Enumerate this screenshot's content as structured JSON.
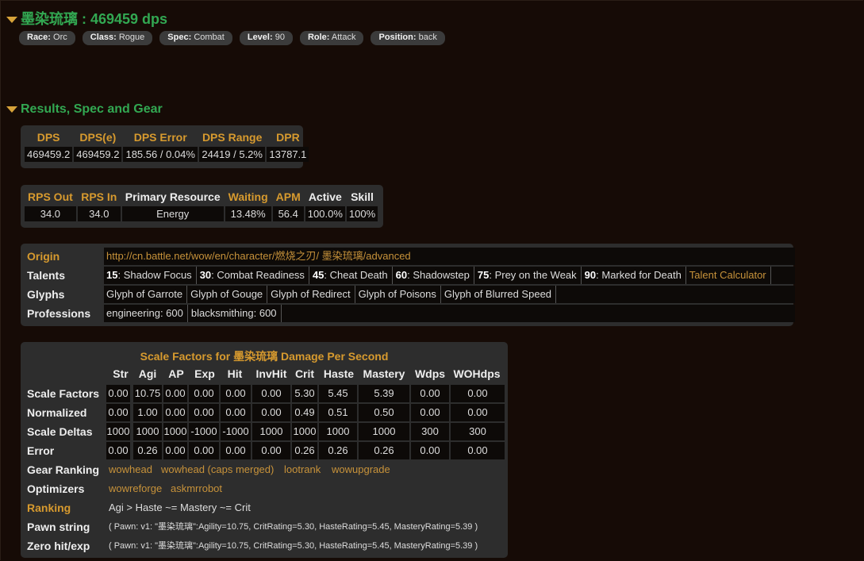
{
  "header": {
    "title": "墨染琉璃 : 469459 dps",
    "pills": [
      {
        "key": "Race:",
        "val": "Orc"
      },
      {
        "key": "Class:",
        "val": "Rogue"
      },
      {
        "key": "Spec:",
        "val": "Combat"
      },
      {
        "key": "Level:",
        "val": "90"
      },
      {
        "key": "Role:",
        "val": "Attack"
      },
      {
        "key": "Position:",
        "val": "back"
      }
    ]
  },
  "section": {
    "title": "Results, Spec and Gear"
  },
  "results1": {
    "headers": [
      "DPS",
      "DPS(e)",
      "DPS Error",
      "DPS Range",
      "DPR"
    ],
    "values": [
      "469459.2",
      "469459.2",
      "185.56 / 0.04%",
      "24419 / 5.2%",
      "13787.1"
    ]
  },
  "results2": {
    "headers": [
      "RPS Out",
      "RPS In",
      "Primary Resource",
      "Waiting",
      "APM",
      "Active",
      "Skill"
    ],
    "values": [
      "34.0",
      "34.0",
      "Energy",
      "13.48%",
      "56.4",
      "100.0%",
      "100%"
    ]
  },
  "info": {
    "origin_label": "Origin",
    "origin_url": "http://cn.battle.net/wow/en/character/燃烧之刃/ 墨染琉璃/advanced",
    "talents_label": "Talents",
    "talents": [
      {
        "tier": "15",
        "name": ": Shadow Focus"
      },
      {
        "tier": "30",
        "name": ": Combat Readiness"
      },
      {
        "tier": "45",
        "name": ": Cheat Death"
      },
      {
        "tier": "60",
        "name": ": Shadowstep"
      },
      {
        "tier": "75",
        "name": ": Prey on the Weak"
      },
      {
        "tier": "90",
        "name": ": Marked for Death"
      }
    ],
    "talent_calc": "Talent Calculator",
    "glyphs_label": "Glyphs",
    "glyphs": [
      "Glyph of Garrote",
      "Glyph of Gouge",
      "Glyph of Redirect",
      "Glyph of Poisons",
      "Glyph of Blurred Speed"
    ],
    "professions_label": "Professions",
    "professions": [
      "engineering: 600",
      "blacksmithing: 600"
    ]
  },
  "scale": {
    "title": "Scale Factors for 墨染琉璃 Damage Per Second",
    "headers": [
      "Str",
      "Agi",
      "AP",
      "Exp",
      "Hit",
      "InvHit",
      "Crit",
      "Haste",
      "Mastery",
      "Wdps",
      "WOHdps"
    ],
    "rows": [
      {
        "label": "Scale Factors",
        "values": [
          "0.00",
          "10.75",
          "0.00",
          "0.00",
          "0.00",
          "0.00",
          "5.30",
          "5.45",
          "5.39",
          "0.00",
          "0.00"
        ]
      },
      {
        "label": "Normalized",
        "values": [
          "0.00",
          "1.00",
          "0.00",
          "0.00",
          "0.00",
          "0.00",
          "0.49",
          "0.51",
          "0.50",
          "0.00",
          "0.00"
        ]
      },
      {
        "label": "Scale Deltas",
        "values": [
          "1000",
          "1000",
          "1000",
          "-1000",
          "-1000",
          "1000",
          "1000",
          "1000",
          "1000",
          "300",
          "300"
        ]
      },
      {
        "label": "Error",
        "values": [
          "0.00",
          "0.26",
          "0.00",
          "0.00",
          "0.00",
          "0.00",
          "0.26",
          "0.26",
          "0.26",
          "0.00",
          "0.00"
        ]
      }
    ],
    "gear_ranking_label": "Gear Ranking",
    "gear_links": [
      "wowhead",
      "wowhead (caps merged)",
      "lootrank",
      "wowupgrade"
    ],
    "optimizers_label": "Optimizers",
    "optimizer_links": [
      "wowreforge",
      "askmrrobot"
    ],
    "ranking_label": "Ranking",
    "ranking_value": "Agi > Haste ~= Mastery ~= Crit",
    "pawn_label": "Pawn string",
    "pawn_value": "( Pawn: v1: \"墨染琉璃\":Agility=10.75, CritRating=5.30, HasteRating=5.45, MasteryRating=5.39 )",
    "zero_label": "Zero hit/exp",
    "zero_value": "( Pawn: v1: \"墨染琉璃\":Agility=10.75, CritRating=5.30, HasteRating=5.45, MasteryRating=5.39 )"
  },
  "colors": {
    "bg": "#160b06",
    "green": "#32a852",
    "orange": "#d79a2e",
    "panel": "#2d2d2d",
    "cell": "#0d0a08"
  }
}
